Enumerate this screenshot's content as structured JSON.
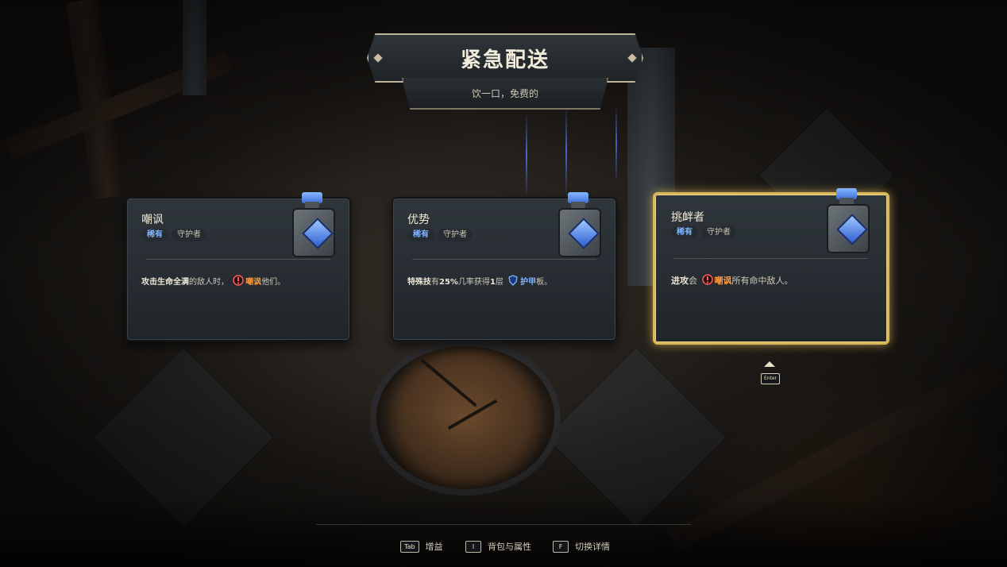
{
  "title": "紧急配送",
  "subtitle": "饮一口，免费的",
  "cards": [
    {
      "name": "嘲讽",
      "rarity": "稀有",
      "class": "守护者",
      "selected": false,
      "icon": "stone-potion-blue-gem-icon",
      "desc": {
        "p1": "攻击生命全满",
        "p2": "的敌人时，",
        "p3": "嘲讽",
        "p4": "他们。"
      }
    },
    {
      "name": "优势",
      "rarity": "稀有",
      "class": "守护者",
      "selected": false,
      "icon": "stone-potion-blue-gem-icon",
      "desc": {
        "p1": "特殊技",
        "p2": "有",
        "p3": "25%",
        "p4": "几率获得",
        "p5": "1",
        "p6": "层",
        "p7": "护甲",
        "p8": "板。"
      }
    },
    {
      "name": "挑衅者",
      "rarity": "稀有",
      "class": "守护者",
      "selected": true,
      "icon": "stone-potion-blue-gem-icon",
      "desc": {
        "p1": "进攻",
        "p2": "会",
        "p3": "嘲讽",
        "p4": "所有命中敌人。"
      }
    }
  ],
  "enter_hint": {
    "key": "Enter"
  },
  "footer": [
    {
      "key": "Tab",
      "label": "增益"
    },
    {
      "key": "I",
      "label": "背包与属性"
    },
    {
      "key": "F",
      "label": "切换详情"
    }
  ],
  "colors": {
    "highlight_orange": "#ff9a3c",
    "rare_blue": "#7fb4ff",
    "selected_gold": "#d8b65a"
  }
}
